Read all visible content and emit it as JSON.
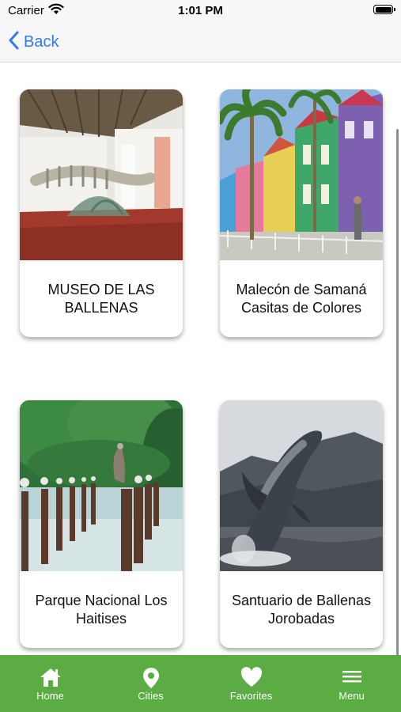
{
  "status_bar": {
    "carrier": "Carrier",
    "time": "1:01 PM"
  },
  "nav_bar": {
    "back_label": "Back"
  },
  "places": [
    {
      "title": "MUSEO DE LAS BALLENAS"
    },
    {
      "title": "Malecón de Samaná Casitas de Colores"
    },
    {
      "title": "Parque Nacional Los Haitises"
    },
    {
      "title": "Santuario de Ballenas Jorobadas"
    }
  ],
  "tab_bar": {
    "color": "#5aac43",
    "tabs": [
      {
        "label": "Home",
        "icon": "home-icon"
      },
      {
        "label": "Cities",
        "icon": "map-pin-icon"
      },
      {
        "label": "Favorites",
        "icon": "heart-icon"
      },
      {
        "label": "Menu",
        "icon": "hamburger-menu-icon"
      }
    ]
  },
  "accent_color": "#2f7bf6"
}
